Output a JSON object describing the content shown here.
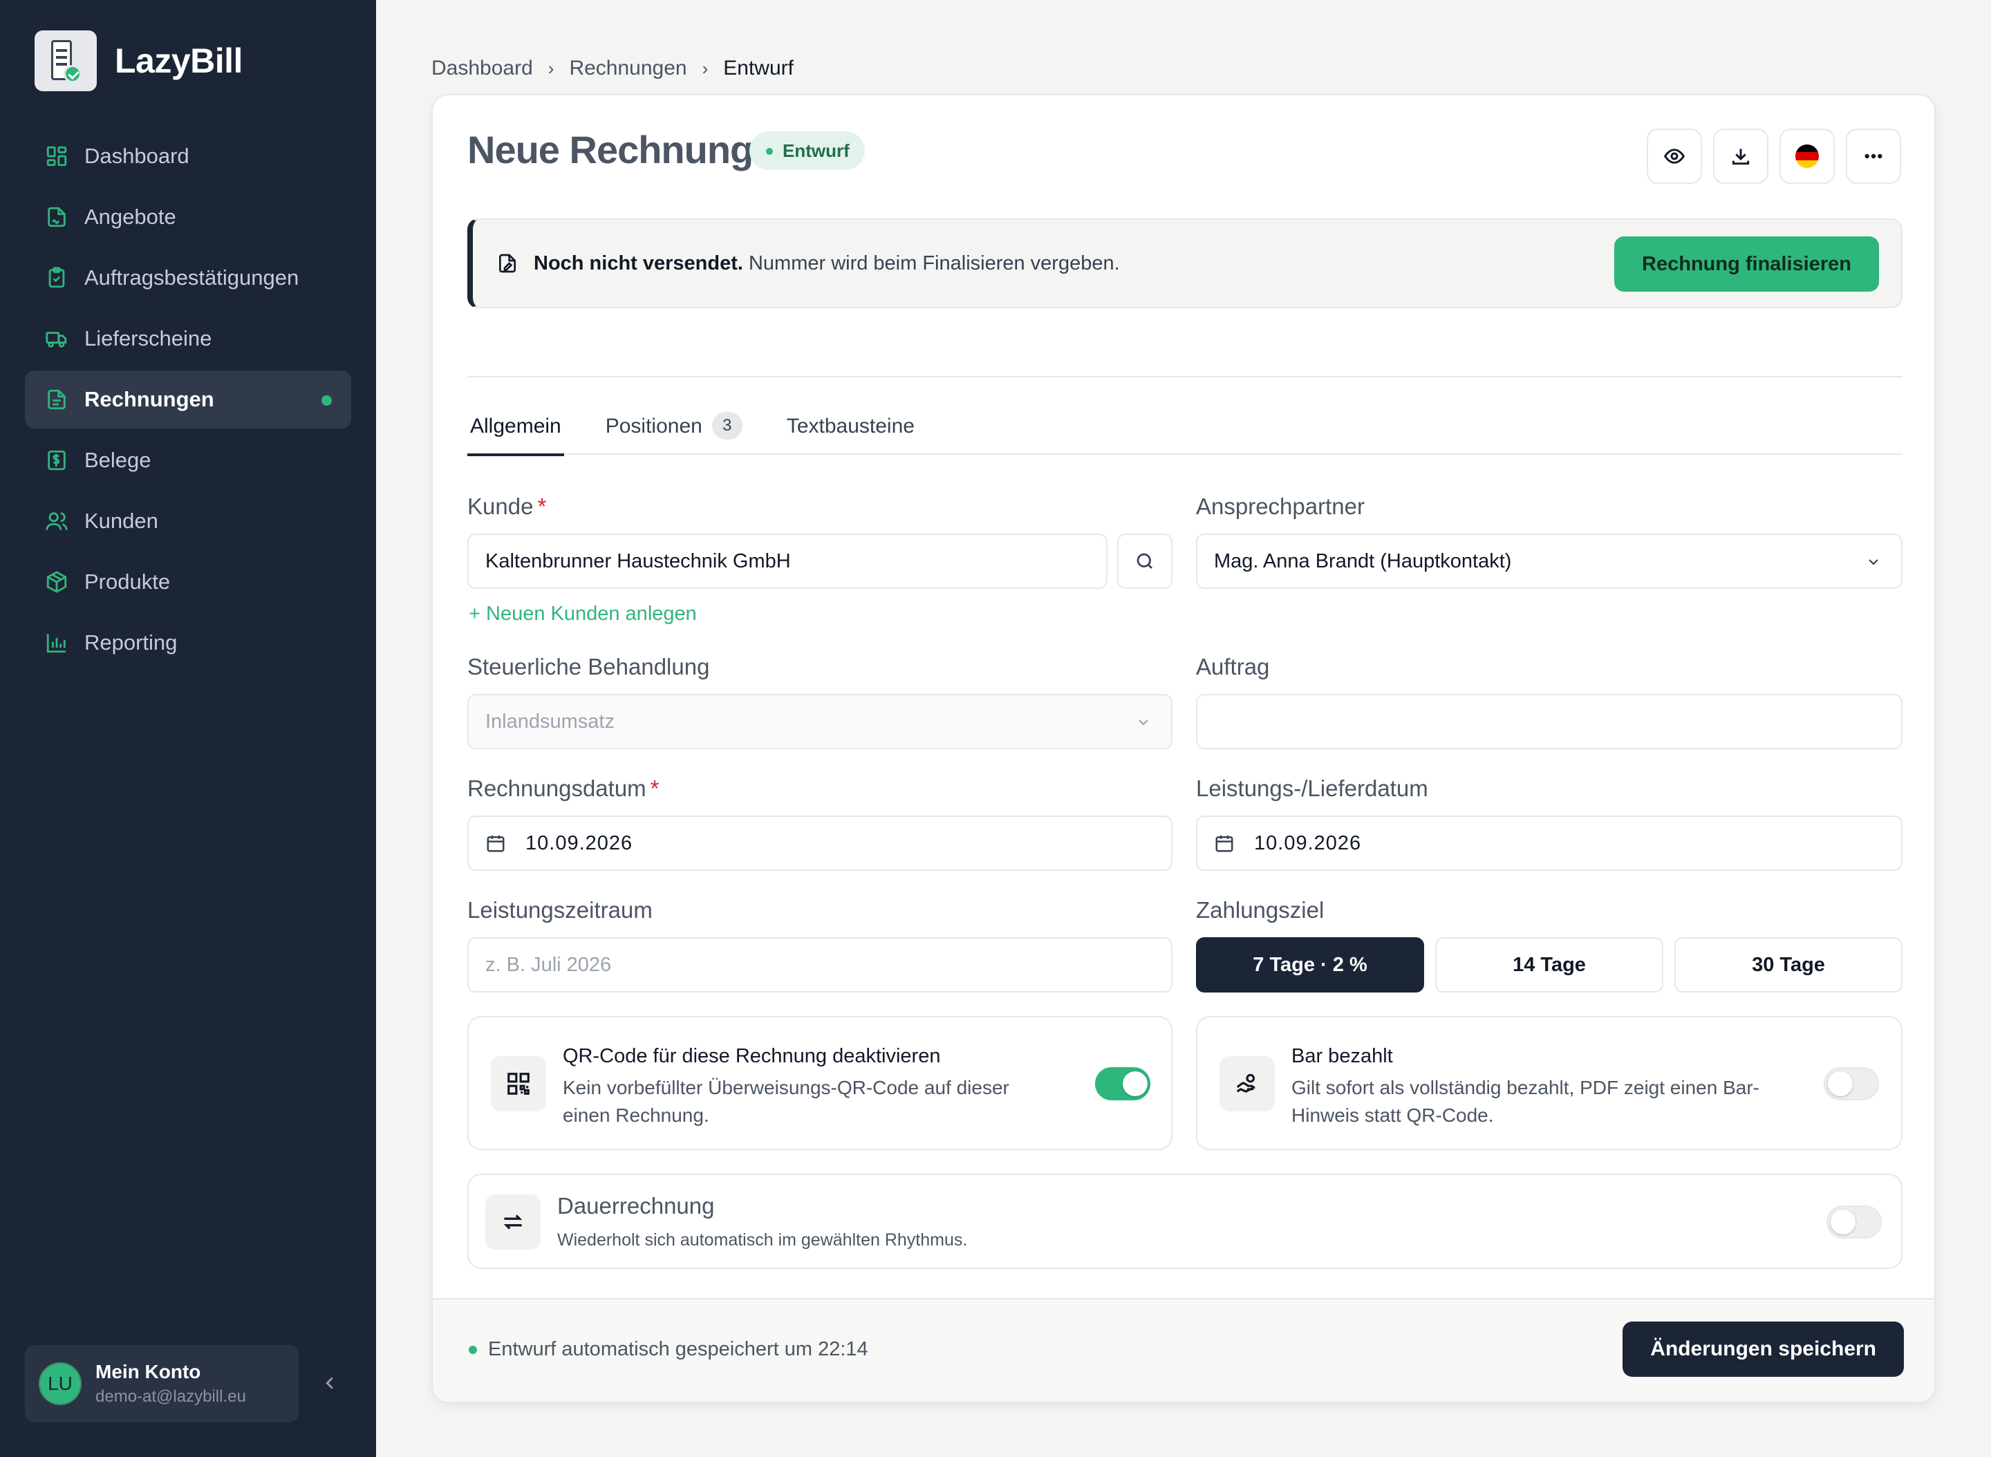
{
  "app": {
    "name": "LazyBill"
  },
  "sidebar": {
    "items": [
      {
        "label": "Dashboard",
        "icon": "dashboard-icon"
      },
      {
        "label": "Angebote",
        "icon": "file-signature-icon"
      },
      {
        "label": "Auftragsbestätigungen",
        "icon": "clipboard-check-icon"
      },
      {
        "label": "Lieferscheine",
        "icon": "truck-icon"
      },
      {
        "label": "Rechnungen",
        "icon": "file-text-icon",
        "active": true
      },
      {
        "label": "Belege",
        "icon": "receipt-icon"
      },
      {
        "label": "Kunden",
        "icon": "users-icon"
      },
      {
        "label": "Produkte",
        "icon": "package-icon"
      },
      {
        "label": "Reporting",
        "icon": "bar-chart-icon"
      }
    ],
    "account": {
      "initials": "LU",
      "name": "Mein Konto",
      "email": "demo-at@lazybill.eu"
    }
  },
  "breadcrumb": {
    "items": [
      "Dashboard",
      "Rechnungen"
    ],
    "current": "Entwurf"
  },
  "page": {
    "title": "Neue Rechnung",
    "status_badge": "Entwurf",
    "notice": {
      "bold": "Noch nicht versendet.",
      "text": "Nummer wird beim Finalisieren vergeben.",
      "button": "Rechnung finalisieren"
    },
    "tabs": [
      {
        "label": "Allgemein",
        "active": true
      },
      {
        "label": "Positionen",
        "count": "3"
      },
      {
        "label": "Textbausteine"
      }
    ]
  },
  "form": {
    "kunde": {
      "label": "Kunde",
      "required": "*",
      "value": "Kaltenbrunner Haustechnik GmbH"
    },
    "new_customer_link": "Neuen Kunden anlegen",
    "ansprechpartner": {
      "label": "Ansprechpartner",
      "value": "Mag. Anna Brandt (Hauptkontakt)"
    },
    "steuer": {
      "label": "Steuerliche Behandlung",
      "value": "Inlandsumsatz"
    },
    "auftrag": {
      "label": "Auftrag",
      "value": ""
    },
    "rechnungsdatum": {
      "label": "Rechnungsdatum",
      "required": "*",
      "value": "10.09.2026"
    },
    "leistungsdatum": {
      "label": "Leistungs-/Lieferdatum",
      "value": "10.09.2026"
    },
    "leistungszeitraum": {
      "label": "Leistungszeitraum",
      "placeholder": "z. B. Juli 2026"
    },
    "zahlungsziel": {
      "label": "Zahlungsziel",
      "options": [
        "7 Tage · 2 %",
        "14 Tage",
        "30 Tage"
      ],
      "selected": "7 Tage · 2 %"
    }
  },
  "options": {
    "qr": {
      "title": "QR-Code für diese Rechnung deaktivieren",
      "desc": "Kein vorbefüllter Überweisungs-QR-Code auf dieser einen Rechnung.",
      "enabled": true
    },
    "bar": {
      "title": "Bar bezahlt",
      "desc": "Gilt sofort als vollständig bezahlt, PDF zeigt einen Bar-Hinweis statt QR-Code.",
      "enabled": false
    },
    "dauer": {
      "title": "Dauerrechnung",
      "desc": "Wiederholt sich automatisch im gewählten Rhythmus.",
      "enabled": false
    }
  },
  "footer": {
    "saved_text": "Entwurf automatisch gespeichert um 22:14",
    "save_button": "Änderungen speichern"
  },
  "colors": {
    "sidebar": "#1c2536",
    "accent": "#2fb67d",
    "dark_button": "#1c2536"
  }
}
